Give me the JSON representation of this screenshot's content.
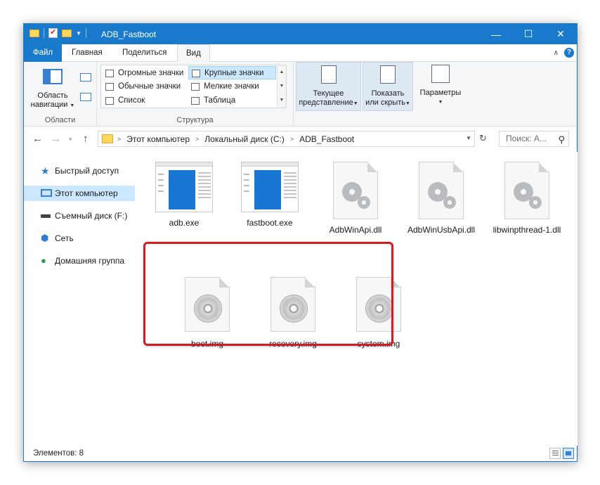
{
  "window": {
    "title": "ADB_Fastboot",
    "controls": {
      "minimize": "—",
      "maximize": "☐",
      "close": "✕"
    }
  },
  "ribbon_tabs": [
    {
      "label": "Файл"
    },
    {
      "label": "Главная"
    },
    {
      "label": "Поделиться"
    },
    {
      "label": "Вид"
    }
  ],
  "ribbon": {
    "areas": {
      "nav_pane_label_line1": "Область",
      "nav_pane_label_line2": "навигации",
      "group_label": "Области"
    },
    "layout": {
      "items": [
        {
          "label": "Огромные значки"
        },
        {
          "label": "Крупные значки"
        },
        {
          "label": "Обычные значки"
        },
        {
          "label": "Мелкие значки"
        },
        {
          "label": "Список"
        },
        {
          "label": "Таблица"
        }
      ],
      "selected": "Крупные значки",
      "group_label": "Структура"
    },
    "current_view": {
      "line1": "Текущее",
      "line2": "представление"
    },
    "show_hide": {
      "line1": "Показать",
      "line2": "или скрыть"
    },
    "options": {
      "label": "Параметры"
    }
  },
  "address": {
    "crumbs": [
      "Этот компьютер",
      "Локальный диск (C:)",
      "ADB_Fastboot"
    ],
    "search_placeholder": "Поиск: А..."
  },
  "nav_pane": [
    {
      "label": "Быстрый доступ",
      "icon": "star-icon"
    },
    {
      "label": "Этот компьютер",
      "icon": "computer-icon",
      "selected": true
    },
    {
      "label": "Съемный диск (F:)",
      "icon": "drive-icon"
    },
    {
      "label": "Сеть",
      "icon": "network-icon"
    },
    {
      "label": "Домашняя группа",
      "icon": "homegroup-icon"
    }
  ],
  "files": [
    {
      "name": "adb.exe",
      "type": "exe"
    },
    {
      "name": "fastboot.exe",
      "type": "exe"
    },
    {
      "name": "AdbWinApi.dll",
      "type": "dll"
    },
    {
      "name": "AdbWinUsbApi.dll",
      "type": "dll"
    },
    {
      "name": "libwinpthread-1.dll",
      "type": "dll"
    },
    {
      "name": "boot.img",
      "type": "img"
    },
    {
      "name": "recovery.img",
      "type": "img"
    },
    {
      "name": "system.img",
      "type": "img"
    }
  ],
  "status": {
    "items_count": "Элементов: 8"
  },
  "colors": {
    "accent": "#1979ca",
    "selection": "#cce8ff",
    "highlight_border": "#cf1e26"
  }
}
